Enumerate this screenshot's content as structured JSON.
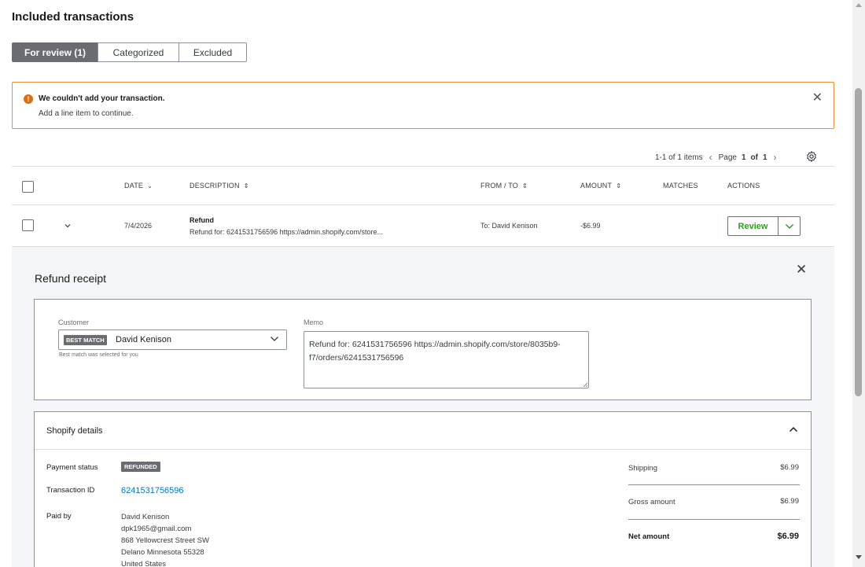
{
  "section": {
    "title": "Included transactions"
  },
  "tabs": [
    {
      "label": "For review (1)"
    },
    {
      "label": "Categorized"
    },
    {
      "label": "Excluded"
    }
  ],
  "alert": {
    "title": "We couldn't add your transaction.",
    "message": "Add a line item to continue.",
    "icon": "warning-icon",
    "color": "#e36c0a"
  },
  "pager": {
    "range": "1-1 of 1 items",
    "page_label": "Page",
    "page_current": "1",
    "page_of": "of",
    "page_total": "1"
  },
  "table": {
    "headers": {
      "date": "DATE",
      "description": "DESCRIPTION",
      "from_to": "FROM / TO",
      "amount": "AMOUNT",
      "matches": "MATCHES",
      "actions": "ACTIONS"
    },
    "rows": [
      {
        "date": "7/4/2026",
        "desc_title": "Refund",
        "desc_sub": "Refund for: 6241531756596 https://admin.shopify.com/store...",
        "from_to": "To: David Kenison",
        "amount": "-$6.99",
        "matches": "",
        "action_label": "Review"
      }
    ]
  },
  "receipt": {
    "title": "Refund receipt",
    "customer_label": "Customer",
    "best_match_badge": "BEST MATCH",
    "customer_value": "David Kenison",
    "customer_hint": "Best match was selected for you",
    "memo_label": "Memo",
    "memo_value": "Refund for: 6241531756596 https://admin.shopify.com/store/8035b9-f7/orders/6241531756596"
  },
  "shopify": {
    "title": "Shopify details",
    "payment_status_label": "Payment status",
    "payment_status_value": "REFUNDED",
    "transaction_id_label": "Transaction ID",
    "transaction_id_value": "6241531756596",
    "paid_by_label": "Paid by",
    "paid_by_lines": [
      "David Kenison",
      "dpk1965@gmail.com",
      "868 Yellowcrest Street SW",
      "Delano Minnesota 55328",
      "United States"
    ],
    "shipping_label": "Shipping",
    "shipping_value": "$6.99",
    "gross_label": "Gross amount",
    "gross_value": "$6.99",
    "net_label": "Net amount",
    "net_value": "$6.99"
  },
  "colors": {
    "accent_green": "#2ca01c",
    "link_blue": "#0077c5",
    "alert_border": "#e88e3c"
  }
}
